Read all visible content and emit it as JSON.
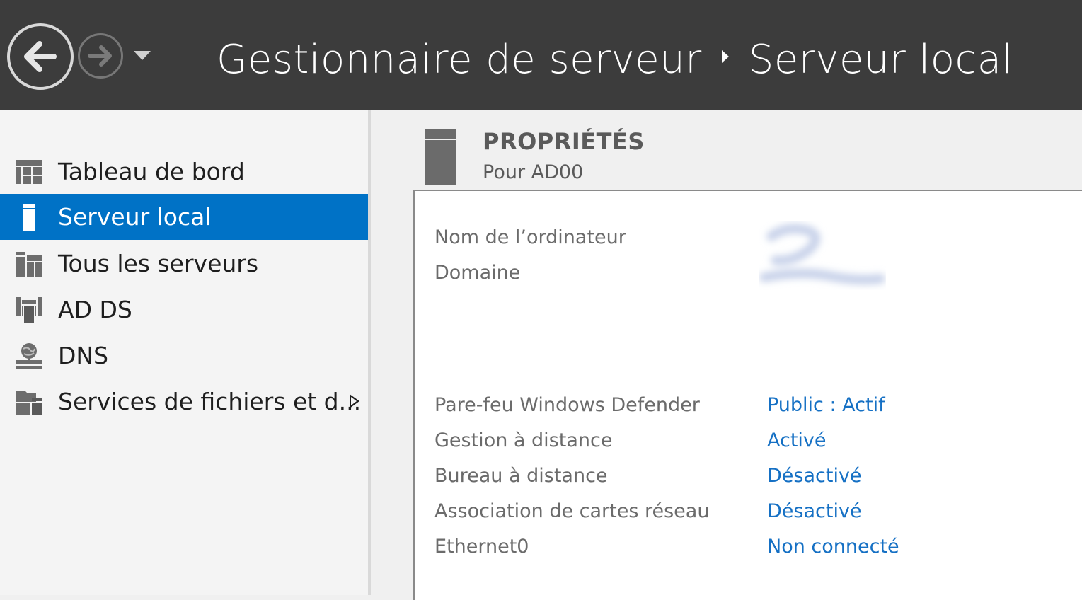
{
  "titlebar": {
    "breadcrumb": {
      "root": "Gestionnaire de serveur",
      "current": "Serveur local"
    },
    "back_icon": "back-arrow-icon",
    "forward_icon": "forward-arrow-icon",
    "history_dropdown_icon": "chevron-down-icon"
  },
  "sidebar": {
    "items": [
      {
        "label": "Tableau de bord",
        "icon": "dashboard-icon",
        "selected": false
      },
      {
        "label": "Serveur local",
        "icon": "local-server-icon",
        "selected": true
      },
      {
        "label": "Tous les serveurs",
        "icon": "all-servers-icon",
        "selected": false
      },
      {
        "label": "AD DS",
        "icon": "ad-ds-icon",
        "selected": false
      },
      {
        "label": "DNS",
        "icon": "dns-icon",
        "selected": false
      },
      {
        "label": "Services de fichiers et d...",
        "icon": "file-services-icon",
        "selected": false,
        "has_submenu": true
      }
    ]
  },
  "properties": {
    "title": "PROPRIÉTÉS",
    "subtitle": "Pour AD00",
    "rows_top": [
      {
        "label": "Nom de l’ordinateur",
        "value": ""
      },
      {
        "label": "Domaine",
        "value": ""
      }
    ],
    "rows_bottom": [
      {
        "label": "Pare-feu Windows Defender",
        "value": "Public : Actif"
      },
      {
        "label": "Gestion à distance",
        "value": "Activé"
      },
      {
        "label": "Bureau à distance",
        "value": "Désactivé"
      },
      {
        "label": "Association de cartes réseau",
        "value": "Désactivé"
      },
      {
        "label": "Ethernet0",
        "value": "Non connecté"
      }
    ]
  },
  "colors": {
    "titlebar_bg": "#3c3c3c",
    "selection_blue": "#0072c6",
    "link_blue": "#1570c4",
    "label_gray": "#6b6b6b"
  }
}
